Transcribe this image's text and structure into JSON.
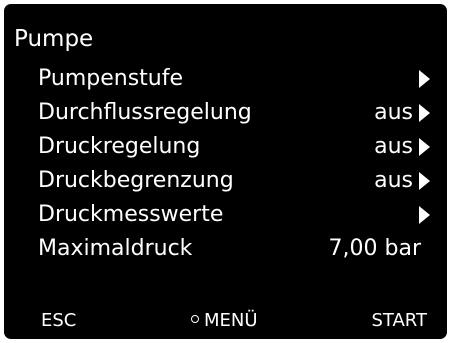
{
  "screen": {
    "title": "Pumpe",
    "items": [
      {
        "label": "Pumpenstufe",
        "value": "",
        "has_arrow": true
      },
      {
        "label": "Durchflussregelung",
        "value": "aus",
        "has_arrow": true
      },
      {
        "label": "Druckregelung",
        "value": "aus",
        "has_arrow": true
      },
      {
        "label": "Druckbegrenzung",
        "value": "aus",
        "has_arrow": true
      },
      {
        "label": "Druckmesswerte",
        "value": "",
        "has_arrow": true
      },
      {
        "label": "Maximaldruck",
        "value": "7,00 bar",
        "has_arrow": false
      }
    ]
  },
  "softkeys": {
    "left": "ESC",
    "middle": "MENÜ",
    "right": "START"
  },
  "colors": {
    "background": "#000000",
    "text": "#ffffff"
  }
}
